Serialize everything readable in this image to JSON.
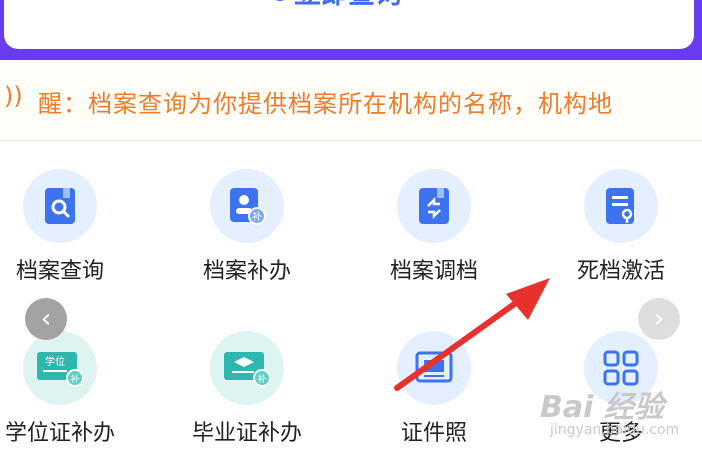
{
  "query": {
    "label": "立即查询",
    "icon": "search-icon"
  },
  "notice": {
    "icon": "speaker-icon",
    "text": "醒：档案查询为你提供档案所在机构的名称，机构地"
  },
  "grid": {
    "items": [
      {
        "label": "档案查询",
        "icon": "archive-search-icon"
      },
      {
        "label": "档案补办",
        "icon": "archive-reissue-icon"
      },
      {
        "label": "档案调档",
        "icon": "archive-transfer-icon"
      },
      {
        "label": "死档激活",
        "icon": "archive-activate-icon"
      },
      {
        "label": "学位证补办",
        "icon": "degree-certificate-icon"
      },
      {
        "label": "毕业证补办",
        "icon": "graduation-certificate-icon"
      },
      {
        "label": "证件照",
        "icon": "id-photo-icon"
      },
      {
        "label": "更多",
        "icon": "more-grid-icon"
      }
    ]
  },
  "nav": {
    "prev": "‹",
    "next": "›"
  },
  "watermark": {
    "brand": "Bai 经验",
    "sub": "jingyan.baidu.com"
  },
  "colors": {
    "accent": "#3d6cf2",
    "brand_purple": "#6a3cf0",
    "notice_orange": "#ef7c2a",
    "annotation_red": "#e8302c"
  }
}
